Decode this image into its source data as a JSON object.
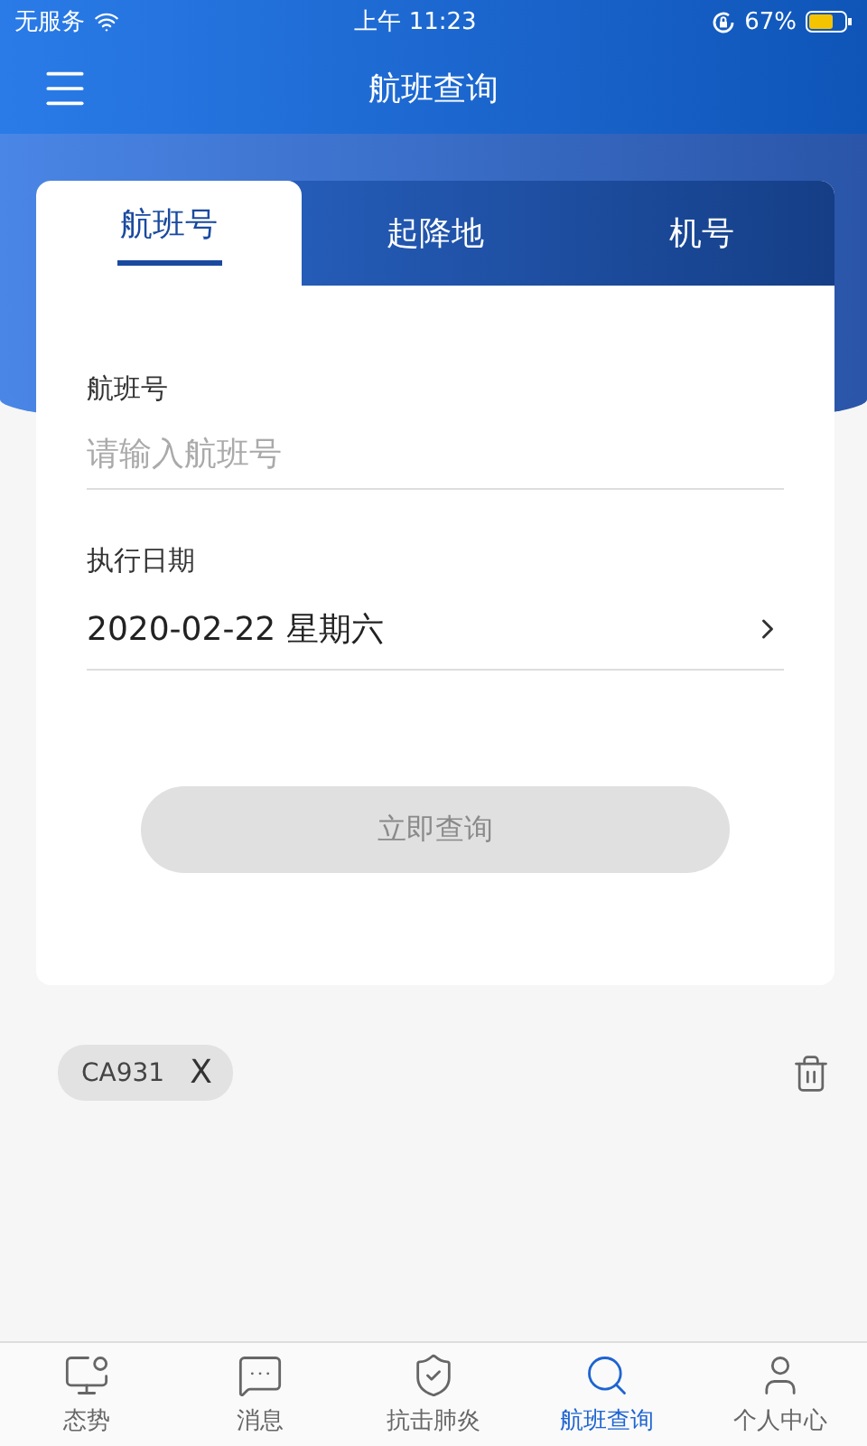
{
  "status_bar": {
    "carrier": "无服务",
    "time": "上午 11:23",
    "battery": "67%"
  },
  "header": {
    "title": "航班查询"
  },
  "tabs": [
    {
      "label": "航班号",
      "selected": true
    },
    {
      "label": "起降地",
      "selected": false
    },
    {
      "label": "机号",
      "selected": false
    }
  ],
  "form": {
    "flight_label": "航班号",
    "flight_placeholder": "请输入航班号",
    "date_label": "执行日期",
    "date_value": "2020-02-22 星期六",
    "search_button": {
      "label": "立即查询",
      "disabled": true
    }
  },
  "history": [
    {
      "label": "CA931",
      "remove": "X"
    }
  ],
  "bottom_nav": [
    {
      "label": "态势",
      "selected": false
    },
    {
      "label": "消息",
      "selected": false
    },
    {
      "label": "抗击肺炎",
      "selected": false
    },
    {
      "label": "航班查询",
      "selected": true
    },
    {
      "label": "个人中心",
      "selected": false
    }
  ]
}
